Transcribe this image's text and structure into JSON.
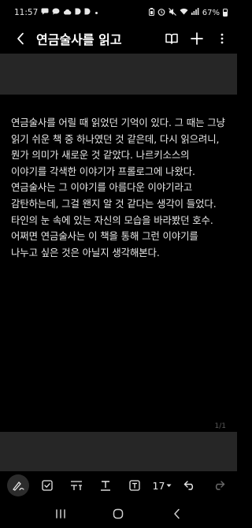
{
  "status_bar": {
    "time": "11:57",
    "battery_text": "67%",
    "battery_level": 0.67,
    "left_icons": [
      "message-icon",
      "chat-bubble-icon",
      "cloud-icon",
      "d-app-icon",
      "d-app-icon",
      "dot-indicator"
    ],
    "right_icons": [
      "battery-saver-icon",
      "alarm-icon",
      "mute-icon",
      "wifi-icon",
      "signal-icon"
    ]
  },
  "header": {
    "title": "연금술사를 읽고",
    "actions": [
      "book-icon",
      "add-icon",
      "more-vert-icon"
    ]
  },
  "note": {
    "body": "연금술사를 어릴 때 읽었던 기억이 있다. 그 때는 그냥 읽기 쉬운 책 중 하나였던 것 같은데, 다시 읽으려니, 뭔가 의미가 새로운 것 같았다. 나르키소스의 이야기를 각색한 이야기가 프롤로그에 나왔다. 연금술사는 그 이야기를 아름다운 이야기라고 감탄하는데, 그걸 왠지 알 것 같다는 생각이 들었다. 타인의 눈 속에 있는 자신의 모습을 바라봤던 호수. 어쩌면 연금술사는 이 책을 통해 그런 이야기를 나누고 싶은 것은 아닐지 생각해본다."
  },
  "page_indicator": "1/1",
  "format_bar": {
    "font_size": "17",
    "tools": [
      "pen-icon",
      "checkbox-icon",
      "text-style-icon",
      "underline-icon",
      "text-box-icon"
    ]
  },
  "colors": {
    "background": "#000000",
    "band": "#262626",
    "text": "#e9e9e9",
    "icon": "#e8e8e8"
  }
}
